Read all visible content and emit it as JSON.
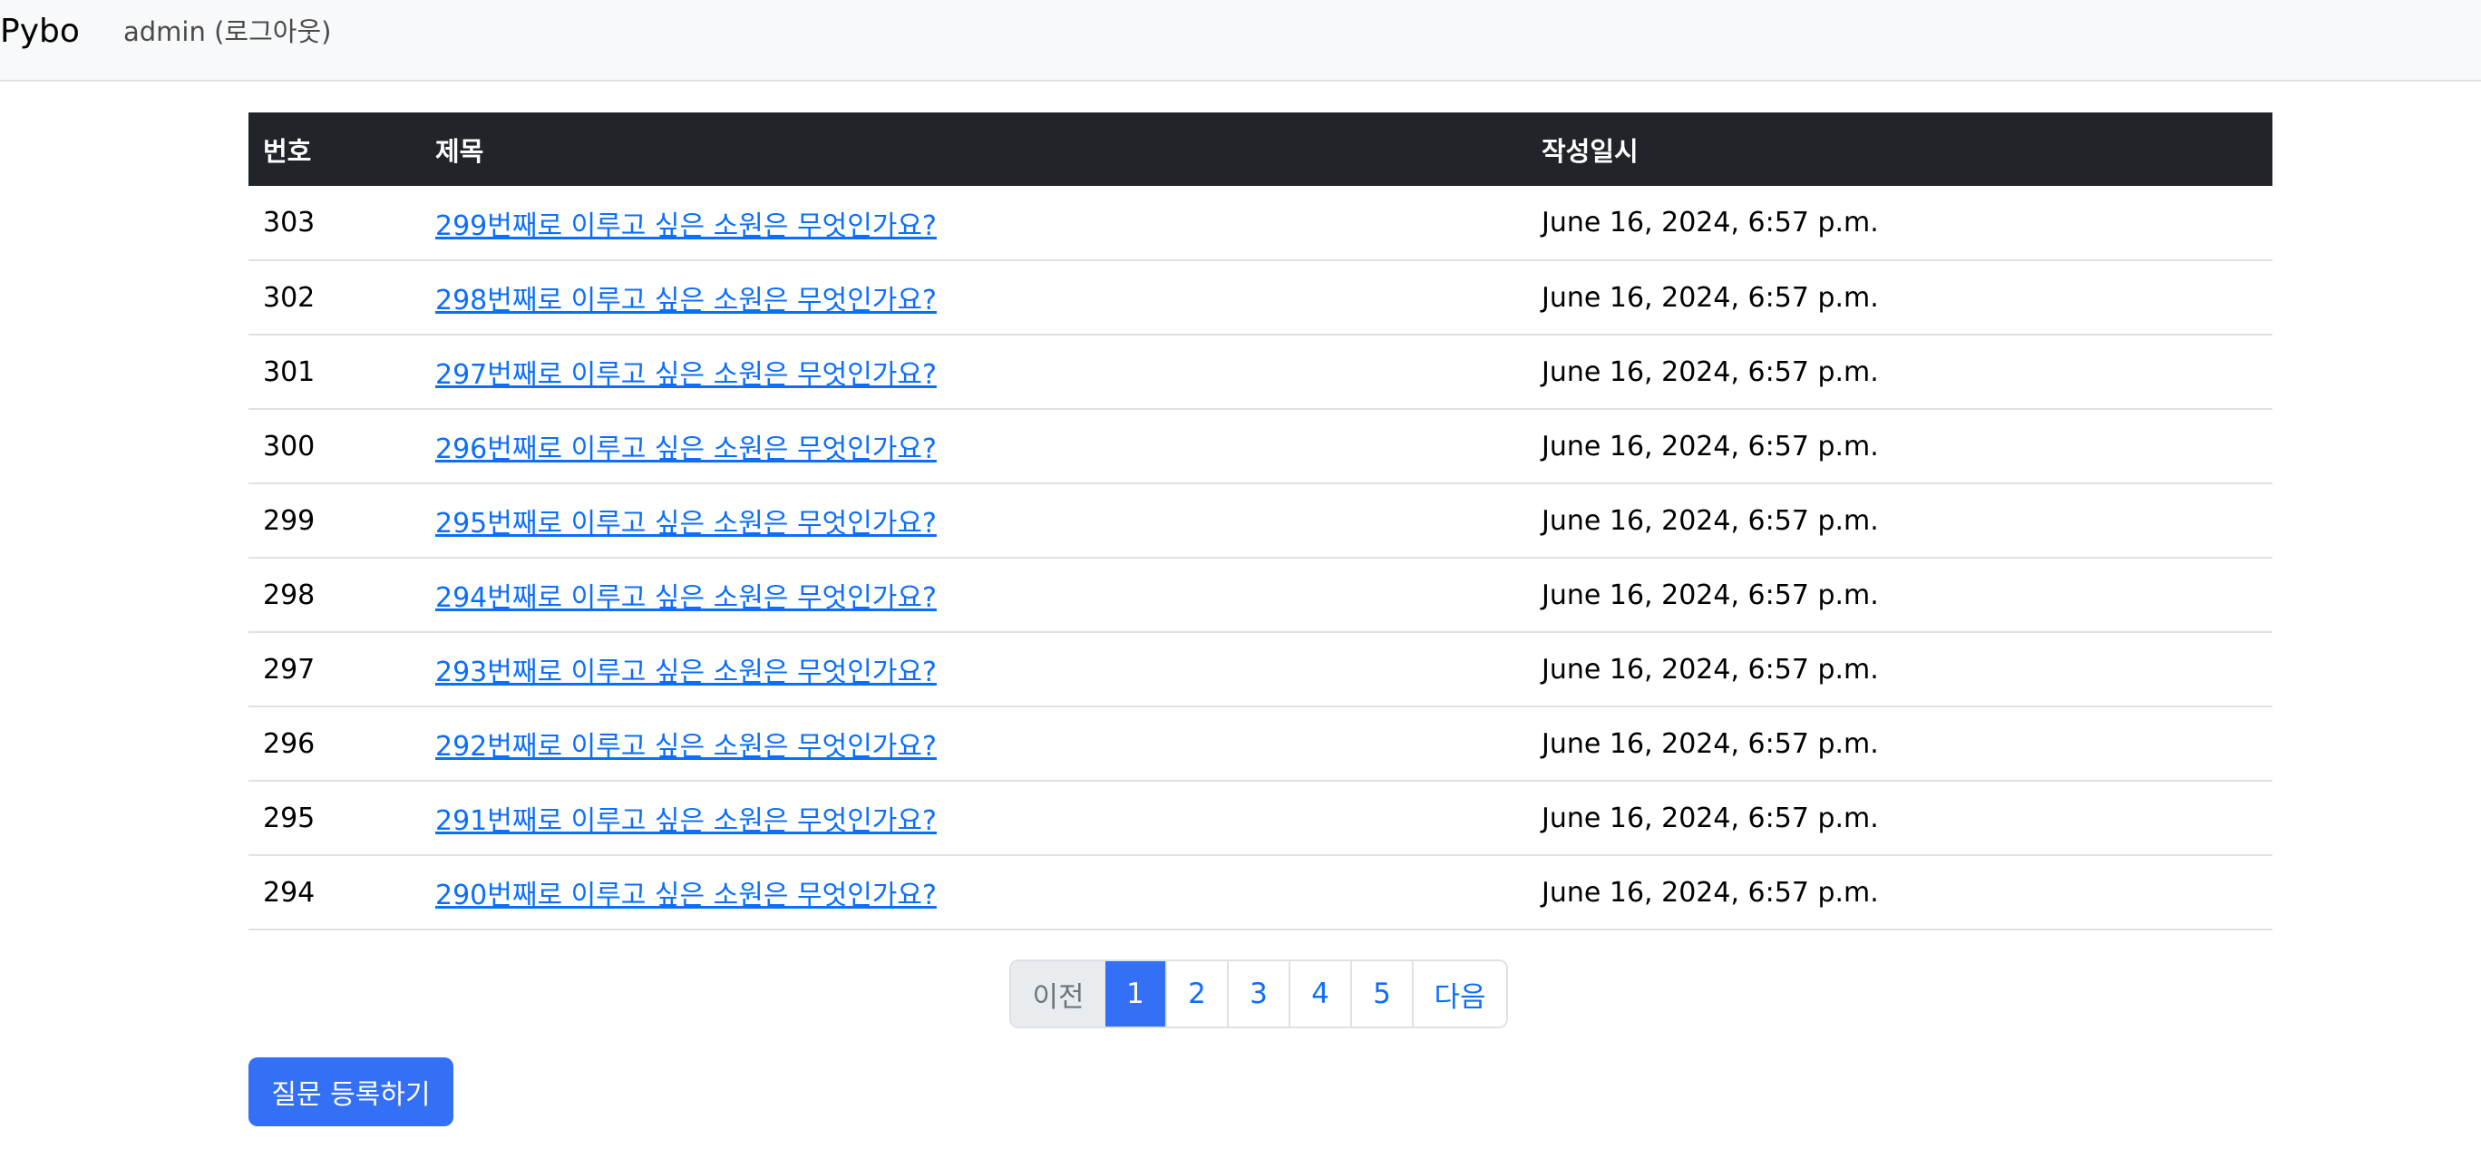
{
  "navbar": {
    "brand": "Pybo",
    "user_link": "admin (로그아웃)"
  },
  "table": {
    "headers": {
      "number": "번호",
      "subject": "제목",
      "created": "작성일시"
    },
    "rows": [
      {
        "number": "303",
        "subject": "299번째로 이루고 싶은 소원은 무엇인가요?",
        "created": "June 16, 2024, 6:57 p.m."
      },
      {
        "number": "302",
        "subject": "298번째로 이루고 싶은 소원은 무엇인가요?",
        "created": "June 16, 2024, 6:57 p.m."
      },
      {
        "number": "301",
        "subject": "297번째로 이루고 싶은 소원은 무엇인가요?",
        "created": "June 16, 2024, 6:57 p.m."
      },
      {
        "number": "300",
        "subject": "296번째로 이루고 싶은 소원은 무엇인가요?",
        "created": "June 16, 2024, 6:57 p.m."
      },
      {
        "number": "299",
        "subject": "295번째로 이루고 싶은 소원은 무엇인가요?",
        "created": "June 16, 2024, 6:57 p.m."
      },
      {
        "number": "298",
        "subject": "294번째로 이루고 싶은 소원은 무엇인가요?",
        "created": "June 16, 2024, 6:57 p.m."
      },
      {
        "number": "297",
        "subject": "293번째로 이루고 싶은 소원은 무엇인가요?",
        "created": "June 16, 2024, 6:57 p.m."
      },
      {
        "number": "296",
        "subject": "292번째로 이루고 싶은 소원은 무엇인가요?",
        "created": "June 16, 2024, 6:57 p.m."
      },
      {
        "number": "295",
        "subject": "291번째로 이루고 싶은 소원은 무엇인가요?",
        "created": "June 16, 2024, 6:57 p.m."
      },
      {
        "number": "294",
        "subject": "290번째로 이루고 싶은 소원은 무엇인가요?",
        "created": "June 16, 2024, 6:57 p.m."
      }
    ]
  },
  "pagination": {
    "prev_label": "이전",
    "pages": [
      "1",
      "2",
      "3",
      "4",
      "5"
    ],
    "current_page": "1",
    "next_label": "다음"
  },
  "actions": {
    "create_question_label": "질문 등록하기"
  },
  "colors": {
    "primary": "#3370f5",
    "link": "#0d6efd",
    "table_header_bg": "#212529",
    "navbar_bg": "#f8f9fa"
  }
}
